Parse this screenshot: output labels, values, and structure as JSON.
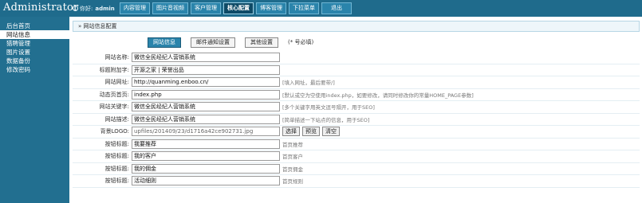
{
  "header": {
    "title": "Administrator",
    "greeting": "你好:",
    "username": "admin",
    "nav": [
      "内容管理",
      "图片音视频",
      "客户管理",
      "核心配置",
      "博客管理",
      "下拉菜单",
      "退出"
    ],
    "nav_active_index": 3
  },
  "sidebar": {
    "items": [
      "后台首页",
      "网站信息",
      "猎聘管理",
      "图片设置",
      "数据备份",
      "修改密码"
    ],
    "active_index": 1
  },
  "breadcrumb": "» 网站信息配置",
  "subtabs": {
    "items": [
      "网站信息",
      "邮件通知设置",
      "其他设置"
    ],
    "active_index": 0,
    "required_note": "(* 号必填)"
  },
  "form": {
    "site_name": {
      "label": "网站名称:",
      "value": "微信全民经纪人营销系统"
    },
    "title_suffix": {
      "label": "标题附加字:",
      "value": "开源之家 | 荣誉出品"
    },
    "site_url": {
      "label": "网站网址:",
      "value": "http://quanming.enboo.cn/",
      "hint": "[填入网址，最后要带/]"
    },
    "home_page": {
      "label": "动态页首页:",
      "value": "index.php",
      "hint": "[默认或空为空使用index.php，如要修改，请同时修改你的常量HOME_PAGE参数]"
    },
    "keywords": {
      "label": "网站关键字:",
      "value": "微信全民经纪人营销系统",
      "hint": "[多个关键字用英文逗号隔开，用于SEO]"
    },
    "description": {
      "label": "网站描述:",
      "value": "微信全民经纪人营销系统",
      "hint": "[简单描述一下站点的信息，用于SEO]"
    },
    "logo": {
      "label": "背景LOGO:",
      "value": "upfiles/201409/23/d1716a42ce902731.jpg",
      "buttons": [
        "选择",
        "预览",
        "清空"
      ]
    },
    "button_titles": [
      {
        "label": "按钮标题:",
        "value": "我要推荐",
        "hint": "首页推荐"
      },
      {
        "label": "按钮标题:",
        "value": "我的客户",
        "hint": "首页客户"
      },
      {
        "label": "按钮标题:",
        "value": "我的佣金",
        "hint": "首页佣金"
      },
      {
        "label": "按钮标题:",
        "value": "活动细则",
        "hint": "首页规则"
      }
    ]
  },
  "colors": {
    "primary": "#1f6b8c",
    "active_tab": "#0e4a66",
    "sub_tab_active": "#2a84ab"
  }
}
